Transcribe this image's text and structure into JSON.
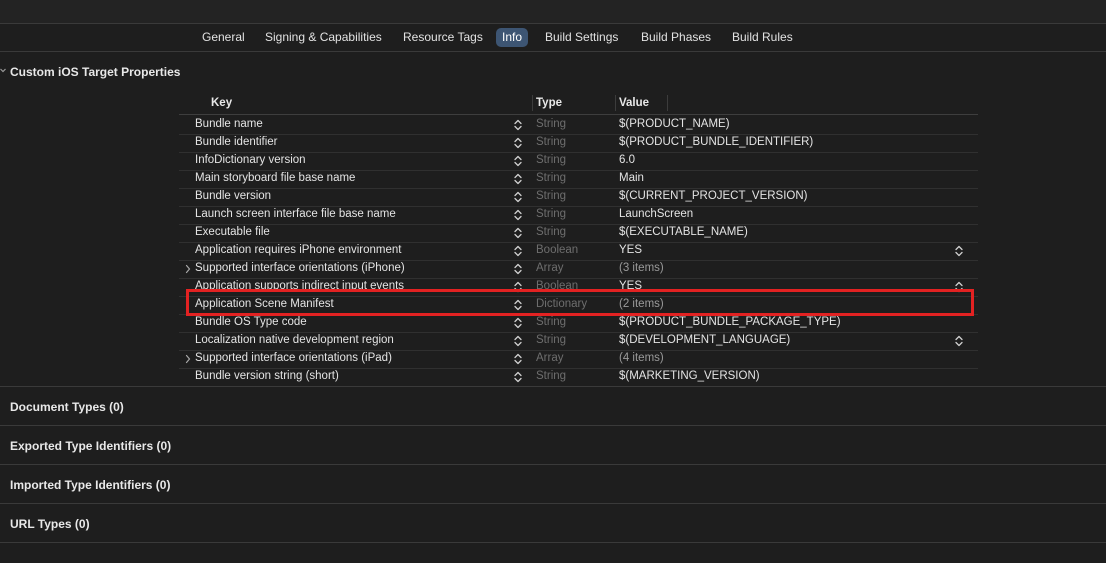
{
  "tabs": [
    {
      "label": "General",
      "active": false
    },
    {
      "label": "Signing & Capabilities",
      "active": false
    },
    {
      "label": "Resource Tags",
      "active": false
    },
    {
      "label": "Info",
      "active": true
    },
    {
      "label": "Build Settings",
      "active": false
    },
    {
      "label": "Build Phases",
      "active": false
    },
    {
      "label": "Build Rules",
      "active": false
    }
  ],
  "custom_properties": {
    "title": "Custom iOS Target Properties",
    "columns": {
      "key": "Key",
      "type": "Type",
      "value": "Value"
    },
    "rows": [
      {
        "key": "Bundle name",
        "type": "String",
        "value": "$(PRODUCT_NAME)"
      },
      {
        "key": "Bundle identifier",
        "type": "String",
        "value": "$(PRODUCT_BUNDLE_IDENTIFIER)"
      },
      {
        "key": "InfoDictionary version",
        "type": "String",
        "value": "6.0"
      },
      {
        "key": "Main storyboard file base name",
        "type": "String",
        "value": "Main"
      },
      {
        "key": "Bundle version",
        "type": "String",
        "value": "$(CURRENT_PROJECT_VERSION)"
      },
      {
        "key": "Launch screen interface file base name",
        "type": "String",
        "value": "LaunchScreen"
      },
      {
        "key": "Executable file",
        "type": "String",
        "value": "$(EXECUTABLE_NAME)"
      },
      {
        "key": "Application requires iPhone environment",
        "type": "Boolean",
        "value": "YES"
      },
      {
        "key": "Supported interface orientations (iPhone)",
        "type": "Array",
        "value": "(3 items)"
      },
      {
        "key": "Application supports indirect input events",
        "type": "Boolean",
        "value": "YES"
      },
      {
        "key": "Application Scene Manifest",
        "type": "Dictionary",
        "value": "(2 items)"
      },
      {
        "key": "Bundle OS Type code",
        "type": "String",
        "value": "$(PRODUCT_BUNDLE_PACKAGE_TYPE)"
      },
      {
        "key": "Localization native development region",
        "type": "String",
        "value": "$(DEVELOPMENT_LANGUAGE)"
      },
      {
        "key": "Supported interface orientations (iPad)",
        "type": "Array",
        "value": "(4 items)"
      },
      {
        "key": "Bundle version string (short)",
        "type": "String",
        "value": "$(MARKETING_VERSION)"
      }
    ]
  },
  "sections": [
    {
      "title": "Document Types (0)"
    },
    {
      "title": "Exported Type Identifiers (0)"
    },
    {
      "title": "Imported Type Identifiers (0)"
    },
    {
      "title": "URL Types (0)"
    }
  ],
  "colors": {
    "active_tab": "#3d5573",
    "highlight": "#e32222",
    "background": "#1e1e1e"
  },
  "icons": {
    "stepper": "up-down-stepper-icon",
    "disclosure": "chevron-right-icon"
  }
}
